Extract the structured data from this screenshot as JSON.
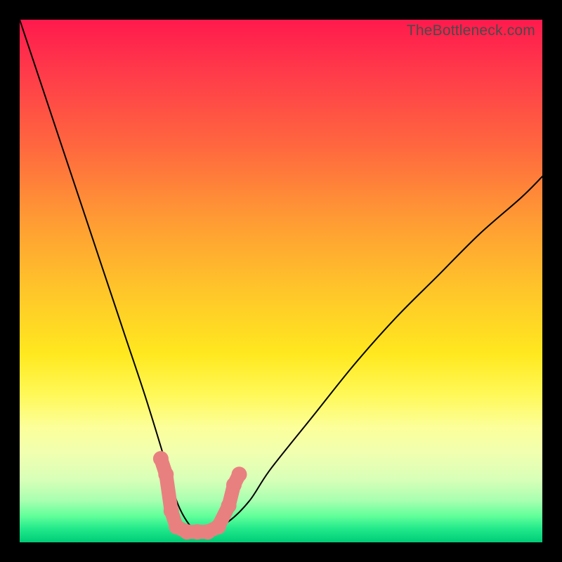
{
  "attribution": "TheBottleneck.com",
  "colors": {
    "gradient_top": "#ff1a4d",
    "gradient_bottom": "#00cc77",
    "curve": "#000000",
    "marker": "#e98080",
    "frame_bg": "#000000"
  },
  "chart_data": {
    "type": "line",
    "title": "",
    "xlabel": "",
    "ylabel": "",
    "xlim": [
      0,
      100
    ],
    "ylim": [
      0,
      100
    ],
    "grid": false,
    "legend": false,
    "note": "Axes implied by plot area; no tick labels shown. y-values are relative bottleneck % where 0 = best (bottom) and 100 = worst (top). Values estimated from curve height against gradient.",
    "series": [
      {
        "name": "bottleneck-curve",
        "x": [
          0,
          4,
          8,
          12,
          16,
          20,
          24,
          28,
          30,
          32,
          34,
          36,
          40,
          44,
          48,
          56,
          64,
          72,
          80,
          88,
          96,
          100
        ],
        "y": [
          100,
          88,
          76,
          64,
          52,
          40,
          28,
          15,
          8,
          4,
          2,
          2,
          4,
          8,
          14,
          24,
          34,
          43,
          51,
          59,
          66,
          70
        ]
      }
    ],
    "markers": {
      "name": "highlight-points",
      "note": "Salmon dots near curve minimum region",
      "points": [
        {
          "x": 27,
          "y": 16
        },
        {
          "x": 28,
          "y": 13
        },
        {
          "x": 29,
          "y": 6
        },
        {
          "x": 30,
          "y": 3
        },
        {
          "x": 32,
          "y": 2
        },
        {
          "x": 34,
          "y": 2
        },
        {
          "x": 36,
          "y": 2
        },
        {
          "x": 38,
          "y": 3
        },
        {
          "x": 40,
          "y": 7
        },
        {
          "x": 41,
          "y": 11
        },
        {
          "x": 42,
          "y": 13
        }
      ]
    }
  }
}
